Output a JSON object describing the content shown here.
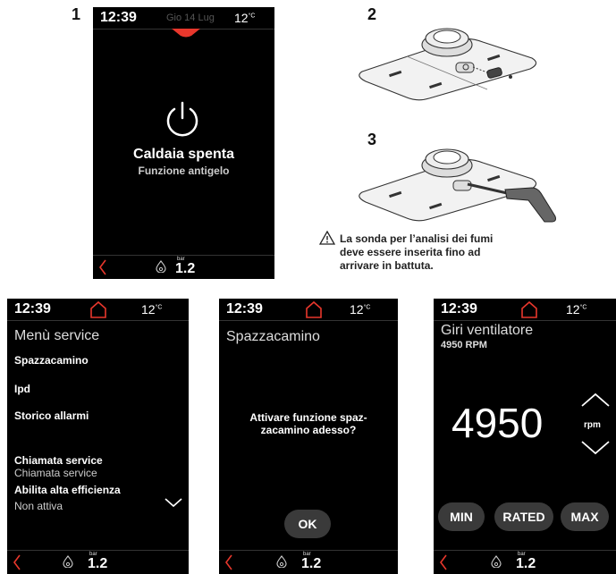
{
  "steps": {
    "one": "1",
    "two": "2",
    "three": "3"
  },
  "screen1": {
    "time": "12:39",
    "date": "Gio 14 Lug",
    "temp": "12",
    "temp_unit": "°C",
    "status": "Caldaia spenta",
    "substatus": "Funzione antigelo",
    "bar_label": "bar",
    "bar_value": "1.2"
  },
  "caption": {
    "line1": "La sonda per l’analisi dei fumi",
    "line2": "deve essere inserita fino ad",
    "line3": "arrivare in battuta."
  },
  "screen2": {
    "time": "12:39",
    "temp": "12",
    "temp_unit": "°C",
    "title": "Menù service",
    "items": [
      "Spazzacamino",
      "Ipd",
      "Storico allarmi",
      "Chiamata service",
      "Abilita alta efficienza"
    ],
    "subs": [
      "Chiamata service",
      "Non attiva"
    ],
    "bar_label": "bar",
    "bar_value": "1.2"
  },
  "screen3": {
    "time": "12:39",
    "temp": "12",
    "temp_unit": "°C",
    "title": "Spazzacamino",
    "question_l1": "Attivare funzione spaz-",
    "question_l2": "zacamino adesso?",
    "ok": "OK",
    "bar_label": "bar",
    "bar_value": "1.2"
  },
  "screen4": {
    "time": "12:39",
    "temp": "12",
    "temp_unit": "°C",
    "title": "Giri ventilatore",
    "rpm_sub": "4950 RPM",
    "value": "4950",
    "unit": "rpm",
    "buttons": [
      "MIN",
      "RATED",
      "MAX"
    ],
    "bar_label": "bar",
    "bar_value": "1.2"
  },
  "colors": {
    "accent": "#e8372c",
    "background": "#000000"
  }
}
